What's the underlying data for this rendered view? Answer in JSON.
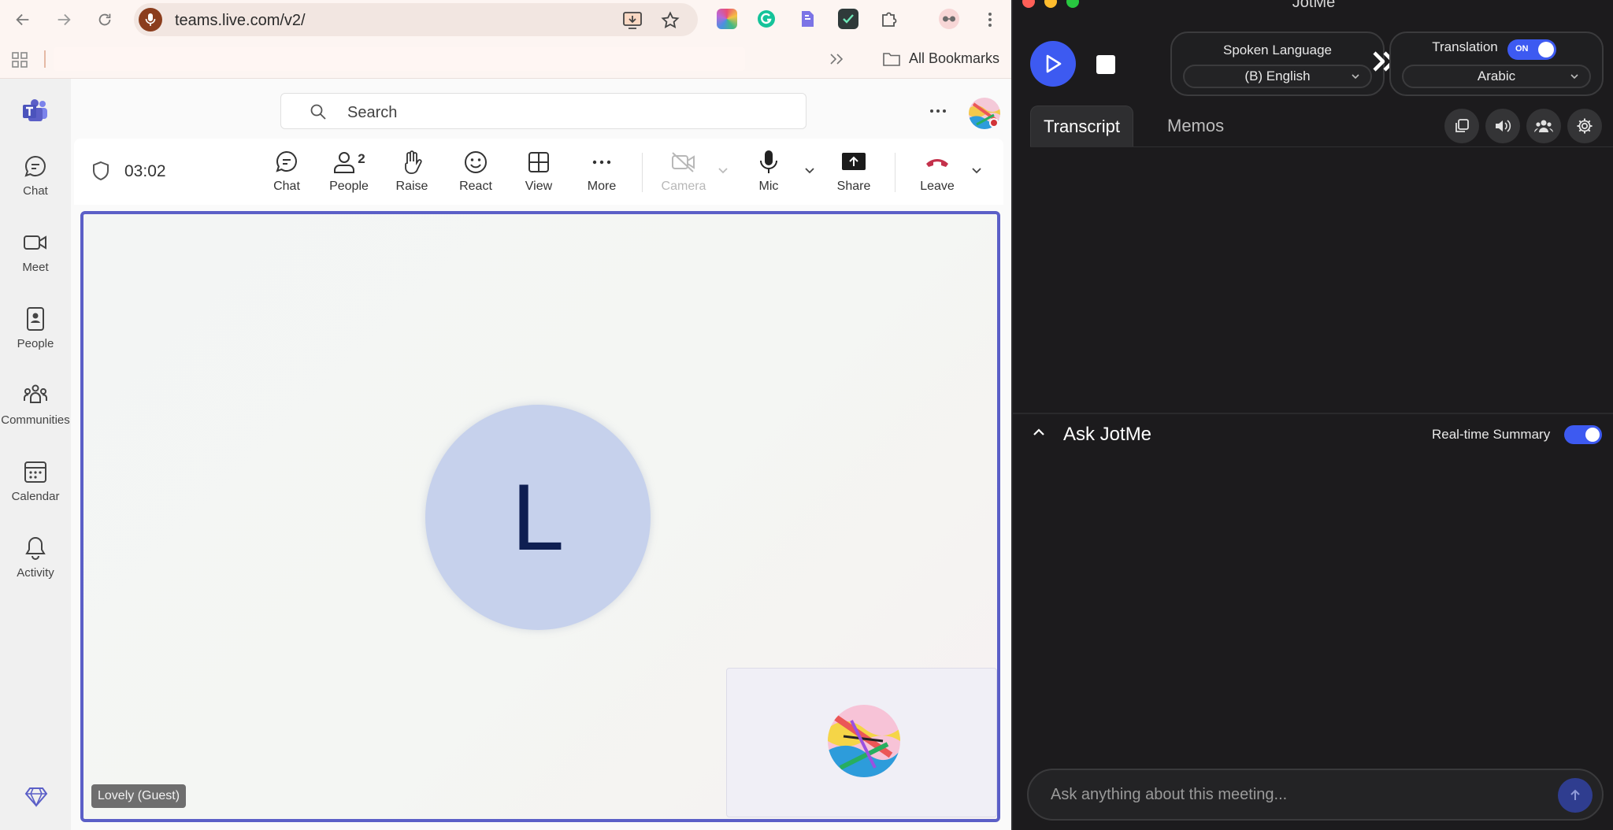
{
  "browser": {
    "url": "teams.live.com/v2/",
    "all_bookmarks_label": "All Bookmarks"
  },
  "teams": {
    "search_placeholder": "Search",
    "rail": [
      {
        "label": "Chat",
        "icon": "chat-icon"
      },
      {
        "label": "Meet",
        "icon": "video-icon"
      },
      {
        "label": "People",
        "icon": "contact-book-icon"
      },
      {
        "label": "Communities",
        "icon": "communities-icon"
      },
      {
        "label": "Calendar",
        "icon": "calendar-icon"
      },
      {
        "label": "Activity",
        "icon": "bell-icon"
      }
    ],
    "meeting": {
      "timer": "03:02",
      "people_count": "2",
      "toolbar": {
        "chat": "Chat",
        "people": "People",
        "raise": "Raise",
        "react": "React",
        "view": "View",
        "more": "More",
        "camera": "Camera",
        "mic": "Mic",
        "share": "Share",
        "leave": "Leave"
      },
      "participant_initial": "L",
      "participant_name": "Lovely (Guest)"
    }
  },
  "jotme": {
    "title": "JotMe",
    "spoken_language_label": "Spoken Language",
    "spoken_language_value": "(B) English",
    "translation_label": "Translation",
    "translation_toggle": "ON",
    "translation_value": "Arabic",
    "tabs": [
      "Transcript",
      "Memos"
    ],
    "ask_title": "Ask JotMe",
    "realtime_summary_label": "Real-time Summary",
    "ask_placeholder": "Ask anything about this meeting..."
  },
  "colors": {
    "teams_accent": "#5b5fc7",
    "jotme_accent": "#3d5af1",
    "leave_red": "#c4314b"
  }
}
